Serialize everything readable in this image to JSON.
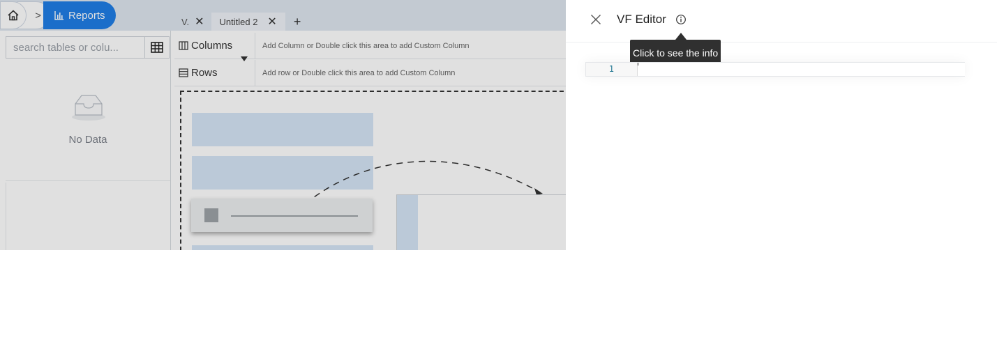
{
  "breadcrumb": {
    "home_icon": "home-icon",
    "separator": ">",
    "reports_icon": "bar-chart-icon",
    "reports_label": "Reports",
    "active_color": "#1f7ee6"
  },
  "tabs": [
    {
      "label": "V.",
      "close": "✕"
    },
    {
      "label": "Untitled 2",
      "close": "✕"
    }
  ],
  "add_tab_label": "+",
  "search": {
    "placeholder": "search tables or colu...",
    "grid_icon": "table-grid-icon"
  },
  "empty_state": {
    "icon": "inbox-icon",
    "label": "No Data"
  },
  "shelves": {
    "columns_label": "Columns",
    "columns_hint": "Add Column or Double click this area to add Custom Column",
    "rows_label": "Rows",
    "rows_hint": "Add row or Double click this area to add Custom Column"
  },
  "drawer": {
    "close_icon": "close-icon",
    "title": "VF Editor",
    "info_icon": "info-icon",
    "tooltip": "Click to see the info"
  },
  "editor": {
    "line_numbers": [
      "1"
    ],
    "lines": [
      ""
    ]
  },
  "colors": {
    "tooltip_bg": "#303030",
    "line_number": "#237893",
    "placeholder_blue": "#d5e5f6"
  }
}
